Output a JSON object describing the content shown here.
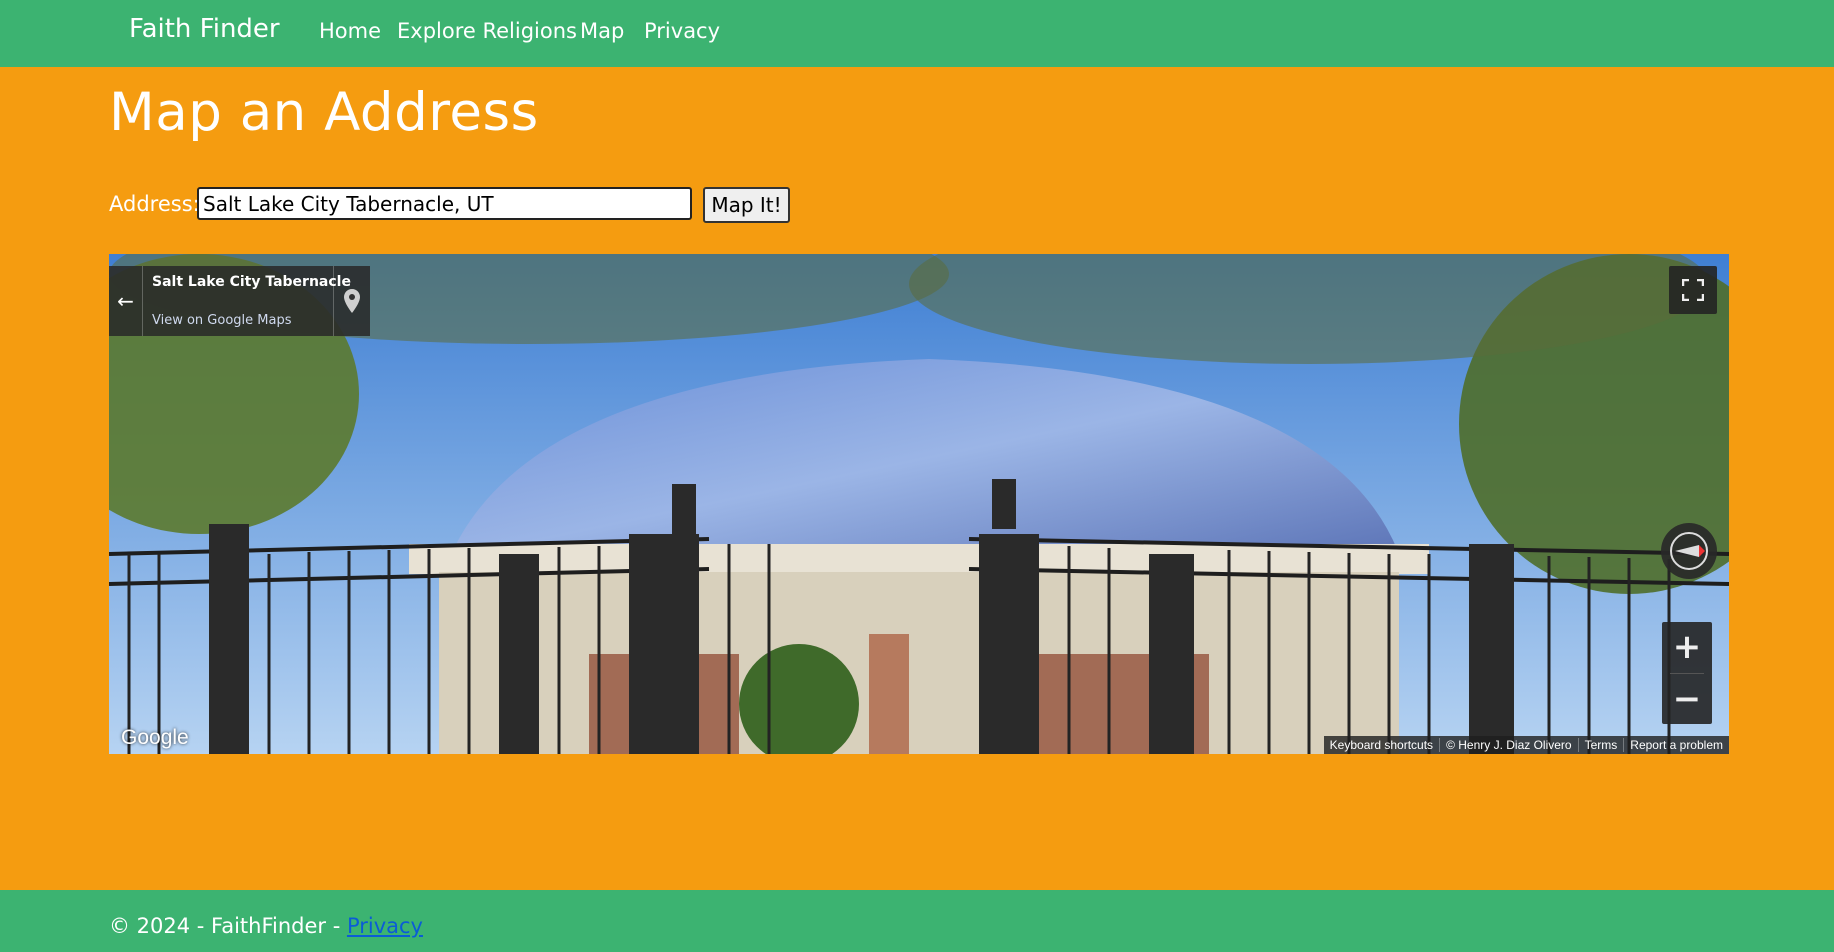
{
  "nav": {
    "brand": "Faith Finder",
    "links": [
      "Home",
      "Explore Religions",
      "Map",
      "Privacy"
    ]
  },
  "page": {
    "title": "Map an Address",
    "address_label": "Address:",
    "address_value": "Salt Lake City Tabernacle, UT",
    "button_label": "Map It!"
  },
  "map": {
    "place_title": "Salt Lake City Tabernacle",
    "view_link": "View on Google Maps",
    "logo": "Google",
    "attribution": [
      "Keyboard shortcuts",
      "© Henry J. Diaz Olivero",
      "Terms",
      "Report a problem"
    ],
    "zoom_in": "+",
    "zoom_out": "−",
    "icons": [
      "back-arrow-icon",
      "map-pin-icon",
      "fullscreen-icon",
      "compass-icon"
    ]
  },
  "footer": {
    "text": "© 2024 - FaithFinder - ",
    "link": "Privacy"
  },
  "colors": {
    "nav_bg": "#3cb371",
    "page_bg": "#f59c10",
    "footer_link": "#0b5cd6"
  }
}
